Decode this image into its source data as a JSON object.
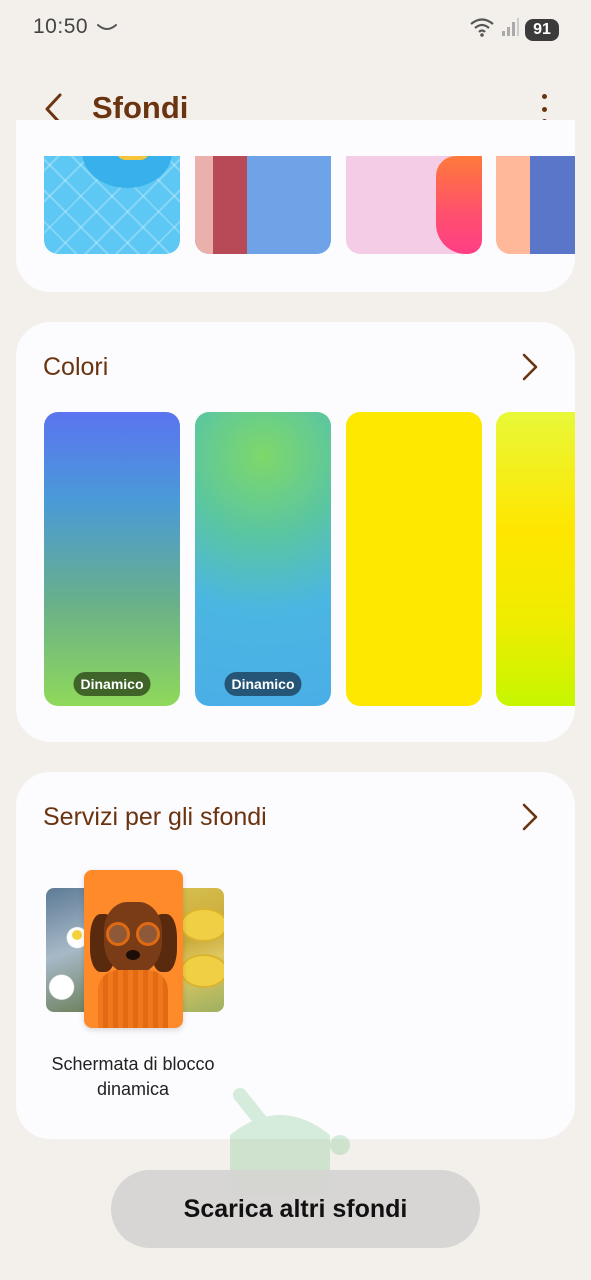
{
  "status_bar": {
    "time": "10:50",
    "battery": "91",
    "icons": [
      "notification-tilde-icon",
      "wifi-icon",
      "signal-icon",
      "battery-icon"
    ]
  },
  "header": {
    "title": "Sfondi",
    "back_icon": "back-arrow-icon",
    "more_icon": "more-options-icon"
  },
  "wallpapers_top": {
    "items": [
      "wallpaper-1",
      "wallpaper-2",
      "wallpaper-3",
      "wallpaper-4"
    ]
  },
  "colors_section": {
    "title": "Colori",
    "items": [
      {
        "badge": "Dinamico"
      },
      {
        "badge": "Dinamico"
      },
      {
        "badge": ""
      },
      {
        "badge": ""
      }
    ]
  },
  "services_section": {
    "title": "Servizi per gli sfondi",
    "items": [
      {
        "label_line1": "Schermata di blocco",
        "label_line2": "dinamica"
      }
    ]
  },
  "footer": {
    "download_label": "Scarica altri sfondi"
  },
  "colors": {
    "background": "#f3f0ec",
    "card": "#fcfbfd",
    "accent_brown": "#6b3410",
    "button_gray": "#d6d4d2"
  }
}
